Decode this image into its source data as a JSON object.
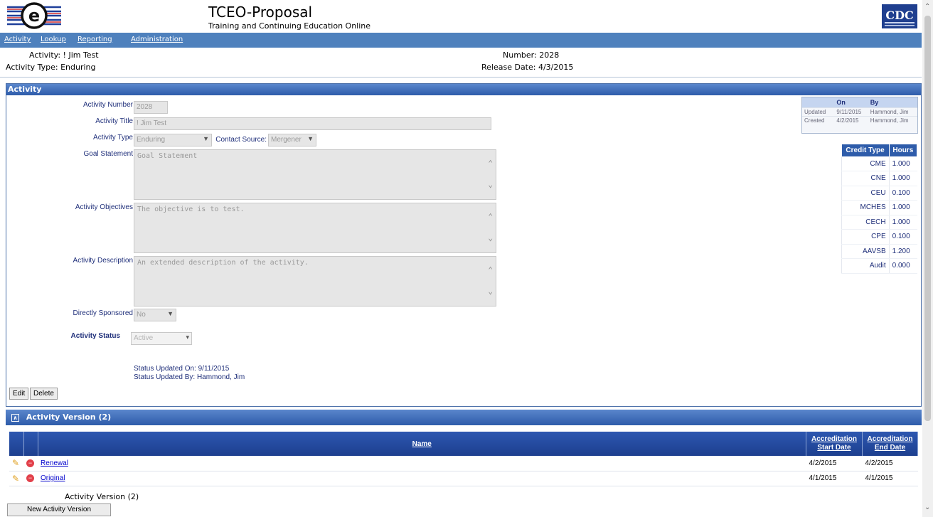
{
  "header": {
    "title": "TCEO-Proposal",
    "subtitle": "Training and Continuing Education Online",
    "cdc_logo_text": "CDC"
  },
  "nav": {
    "items": [
      {
        "label": "Activity"
      },
      {
        "label": "Lookup"
      },
      {
        "label": "Reporting"
      },
      {
        "label": "Administration"
      }
    ]
  },
  "summary": {
    "activity": "Activity: ! Jim Test",
    "activity_type": "Activity Type: Enduring",
    "number": "Number: 2028",
    "release_date": "Release Date: 4/3/2015"
  },
  "activity_panel": {
    "title": "Activity",
    "labels": {
      "activity_number": "Activity Number",
      "activity_title": "Activity Title",
      "activity_type": "Activity Type",
      "contact_source": "Contact Source:",
      "goal_statement": "Goal Statement",
      "activity_objectives": "Activity Objectives",
      "activity_description": "Activity Description",
      "directly_sponsored": "Directly Sponsored",
      "activity_status": "Activity Status"
    },
    "values": {
      "activity_number": "2028",
      "activity_title": "! Jim Test",
      "activity_type": "Enduring",
      "contact_source": "Mergener",
      "goal_statement": "Goal Statement",
      "activity_objectives": "The objective is to test.",
      "activity_description": "An extended description of the activity.",
      "directly_sponsored": "No",
      "activity_status": "Active"
    },
    "status_updated_on": "Status Updated On: 9/11/2015",
    "status_updated_by": "Status Updated By: Hammond, Jim",
    "edit_label": "Edit",
    "delete_label": "Delete"
  },
  "audit": {
    "col_on": "On",
    "col_by": "By",
    "rows": [
      {
        "label": "Updated",
        "on": "9/11/2015",
        "by": "Hammond, Jim"
      },
      {
        "label": "Created",
        "on": "4/2/2015",
        "by": "Hammond, Jim"
      }
    ]
  },
  "credits": {
    "col_type": "Credit Type",
    "col_hours": "Hours",
    "rows": [
      {
        "type": "CME",
        "hours": "1.000"
      },
      {
        "type": "CNE",
        "hours": "1.000"
      },
      {
        "type": "CEU",
        "hours": "0.100"
      },
      {
        "type": "MCHES",
        "hours": "1.000"
      },
      {
        "type": "CECH",
        "hours": "1.000"
      },
      {
        "type": "CPE",
        "hours": "0.100"
      },
      {
        "type": "AAVSB",
        "hours": "1.200"
      },
      {
        "type": "Audit",
        "hours": "0.000"
      }
    ]
  },
  "versions": {
    "title": "Activity Version (2)",
    "col_name": "Name",
    "col_start_1": "Accreditation",
    "col_start_2": "Start Date",
    "col_end_1": "Accreditation",
    "col_end_2": "End Date",
    "rows": [
      {
        "name": "Renewal",
        "start": "4/2/2015",
        "end": "4/2/2015"
      },
      {
        "name": "Original",
        "start": "4/1/2015",
        "end": "4/1/2015"
      }
    ],
    "footer": "Activity Version (2)",
    "new_button": "New Activity Version"
  }
}
